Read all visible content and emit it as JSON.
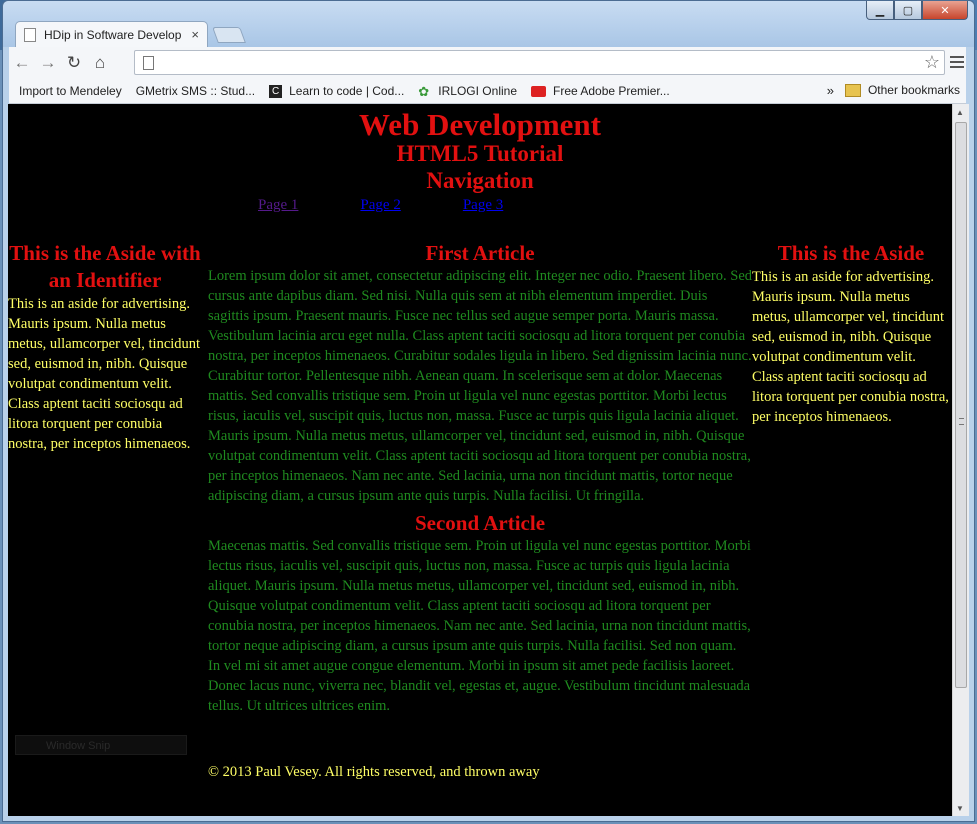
{
  "browser": {
    "tab_title": "HDip in Software Develop",
    "tab_close": "×",
    "window_controls": {
      "minimize": "▁",
      "maximize": "▢",
      "close": "✕"
    },
    "nav_back": "←",
    "nav_forward": "→",
    "reload": "↻",
    "home": "⌂",
    "address": "",
    "star": "☆",
    "bookmarks": [
      {
        "label": "Import to Mendeley",
        "icon": "page-icon"
      },
      {
        "label": "GMetrix SMS :: Stud...",
        "icon": "page-icon"
      },
      {
        "label": "Learn to code | Cod...",
        "icon": "codecademy-icon"
      },
      {
        "label": "IRLOGI Online",
        "icon": "gear-icon"
      },
      {
        "label": "Free Adobe Premier...",
        "icon": "youtube-icon"
      }
    ],
    "bookmarks_overflow": "»",
    "other_bookmarks": "Other bookmarks"
  },
  "page": {
    "title": "Web Development",
    "subtitle": "HTML5 Tutorial",
    "nav_heading": "Navigation",
    "nav_links": [
      "Page 1",
      "Page 2",
      "Page 3"
    ],
    "aside_left": {
      "title": "This is the Aside with an Identifier",
      "text": "This is an aside for advertising. Mauris ipsum. Nulla metus metus, ullamcorper vel, tincidunt sed, euismod in, nibh. Quisque volutpat condimentum velit. Class aptent taciti sociosqu ad litora torquent per conubia nostra, per inceptos himenaeos."
    },
    "aside_right": {
      "title": "This is the Aside",
      "text": "This is an aside for advertising. Mauris ipsum. Nulla metus metus, ullamcorper vel, tincidunt sed, euismod in, nibh. Quisque volutpat condimentum velit. Class aptent taciti sociosqu ad litora torquent per conubia nostra, per inceptos himenaeos."
    },
    "articles": [
      {
        "title": "First Article",
        "text": "Lorem ipsum dolor sit amet, consectetur adipiscing elit. Integer nec odio. Praesent libero. Sed cursus ante dapibus diam. Sed nisi. Nulla quis sem at nibh elementum imperdiet. Duis sagittis ipsum. Praesent mauris. Fusce nec tellus sed augue semper porta. Mauris massa. Vestibulum lacinia arcu eget nulla. Class aptent taciti sociosqu ad litora torquent per conubia nostra, per inceptos himenaeos. Curabitur sodales ligula in libero. Sed dignissim lacinia nunc. Curabitur tortor. Pellentesque nibh. Aenean quam. In scelerisque sem at dolor. Maecenas mattis. Sed convallis tristique sem. Proin ut ligula vel nunc egestas porttitor. Morbi lectus risus, iaculis vel, suscipit quis, luctus non, massa. Fusce ac turpis quis ligula lacinia aliquet. Mauris ipsum. Nulla metus metus, ullamcorper vel, tincidunt sed, euismod in, nibh. Quisque volutpat condimentum velit. Class aptent taciti sociosqu ad litora torquent per conubia nostra, per inceptos himenaeos. Nam nec ante. Sed lacinia, urna non tincidunt mattis, tortor neque adipiscing diam, a cursus ipsum ante quis turpis. Nulla facilisi. Ut fringilla."
      },
      {
        "title": "Second Article",
        "text": "Maecenas mattis. Sed convallis tristique sem. Proin ut ligula vel nunc egestas porttitor. Morbi lectus risus, iaculis vel, suscipit quis, luctus non, massa. Fusce ac turpis quis ligula lacinia aliquet. Mauris ipsum. Nulla metus metus, ullamcorper vel, tincidunt sed, euismod in, nibh. Quisque volutpat condimentum velit. Class aptent taciti sociosqu ad litora torquent per conubia nostra, per inceptos himenaeos. Nam nec ante. Sed lacinia, urna non tincidunt mattis, tortor neque adipiscing diam, a cursus ipsum ante quis turpis. Nulla facilisi. Sed non quam. In vel mi sit amet augue congue elementum. Morbi in ipsum sit amet pede facilisis laoreet. Donec lacus nunc, viverra nec, blandit vel, egestas et, augue. Vestibulum tincidunt malesuada tellus. Ut ultrices ultrices enim."
      }
    ],
    "footer": "© 2013 Paul Vesey. All rights reserved, and thrown away",
    "overlay_label": "Window Snip"
  },
  "colors": {
    "heading": "#e21010",
    "aside_text": "#ffff66",
    "article_text": "#1f8a1f",
    "background": "#000000"
  }
}
